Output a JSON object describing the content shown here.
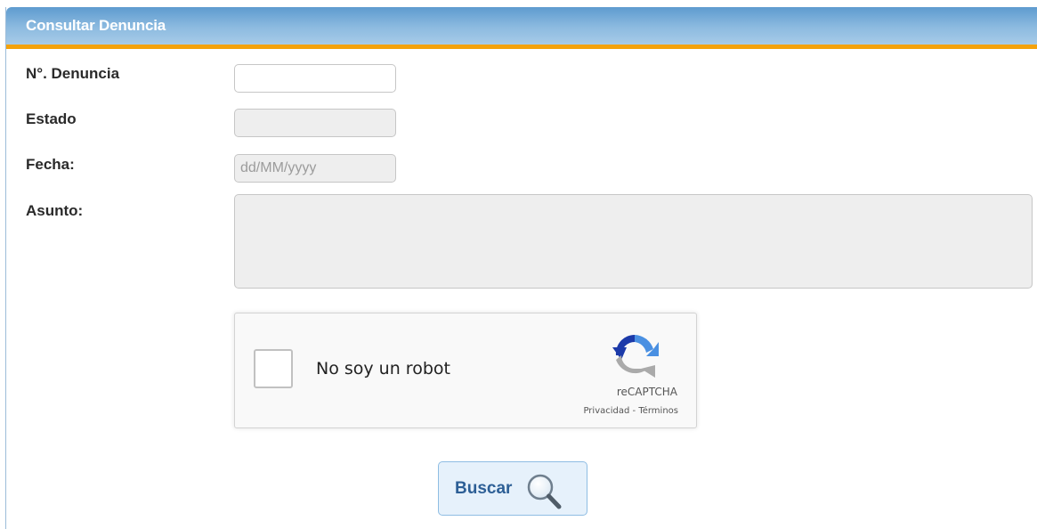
{
  "panel": {
    "title": "Consultar Denuncia"
  },
  "form": {
    "numero_label": "N°. Denuncia",
    "numero_value": "",
    "estado_label": "Estado",
    "estado_value": "",
    "fecha_label": "Fecha:",
    "fecha_placeholder": "dd/MM/yyyy",
    "asunto_label": "Asunto:",
    "asunto_value": ""
  },
  "captcha": {
    "checkbox_label": "No soy un robot",
    "brand": "reCAPTCHA",
    "privacy_link": "Privacidad",
    "separator": " - ",
    "terms_link": "Términos",
    "checked": false
  },
  "actions": {
    "search_label": "Buscar",
    "search_icon": "magnifier-icon"
  },
  "colors": {
    "header_gradient_start": "#5e9bcf",
    "header_accent_border": "#f4a20c",
    "button_text": "#2d5f96"
  }
}
